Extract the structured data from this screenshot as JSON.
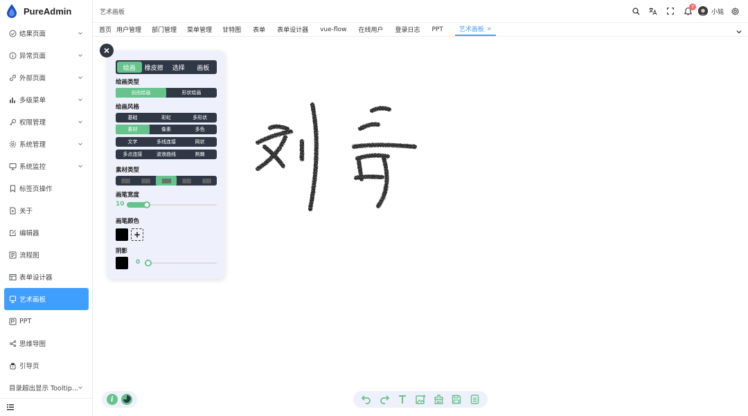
{
  "app": {
    "name": "PureAdmin"
  },
  "sidebar": {
    "items": [
      {
        "label": "结果页面",
        "icon": "check-circle-icon",
        "expandable": true
      },
      {
        "label": "异常页面",
        "icon": "info-circle-icon",
        "expandable": true
      },
      {
        "label": "外部页面",
        "icon": "link-icon",
        "expandable": true
      },
      {
        "label": "多级菜单",
        "icon": "bar-chart-icon",
        "expandable": true
      },
      {
        "label": "权限管理",
        "icon": "key-icon",
        "expandable": true
      },
      {
        "label": "系统管理",
        "icon": "gear-icon",
        "expandable": true
      },
      {
        "label": "系统监控",
        "icon": "monitor-icon",
        "expandable": true
      },
      {
        "label": "标签页操作",
        "icon": "bookmark-icon",
        "expandable": false
      },
      {
        "label": "关于",
        "icon": "document-icon",
        "expandable": false
      },
      {
        "label": "编辑器",
        "icon": "edit-icon",
        "expandable": false
      },
      {
        "label": "流程图",
        "icon": "flowchart-icon",
        "expandable": false
      },
      {
        "label": "表单设计器",
        "icon": "form-icon",
        "expandable": false
      },
      {
        "label": "艺术画板",
        "icon": "drawing-board-icon",
        "expandable": false,
        "active": true
      },
      {
        "label": "PPT",
        "icon": "ppt-icon",
        "expandable": false
      },
      {
        "label": "思维导图",
        "icon": "mindmap-icon",
        "expandable": false
      },
      {
        "label": "引导页",
        "icon": "guide-icon",
        "expandable": false
      },
      {
        "label": "目录超出显示 Tooltip...",
        "icon": "",
        "expandable": true
      }
    ]
  },
  "header": {
    "breadcrumb": "艺术画板",
    "notification_count": "7",
    "username": "小铭"
  },
  "tabs": [
    {
      "label": "首页"
    },
    {
      "label": "用户管理"
    },
    {
      "label": "部门管理"
    },
    {
      "label": "菜单管理"
    },
    {
      "label": "甘特图"
    },
    {
      "label": "表单"
    },
    {
      "label": "表单设计器"
    },
    {
      "label": "vue-flow"
    },
    {
      "label": "在线用户"
    },
    {
      "label": "登录日志"
    },
    {
      "label": "PPT"
    },
    {
      "label": "艺术画板",
      "active": true
    }
  ],
  "panel": {
    "modes": [
      "绘画",
      "橡皮擦",
      "选择",
      "画板"
    ],
    "active_mode": "绘画",
    "draw_type_title": "绘画类型",
    "draw_types": [
      "自由绘画",
      "形状绘画"
    ],
    "style_title": "绘画风格",
    "style_rows": [
      [
        "基础",
        "彩虹",
        "多形状"
      ],
      [
        "素材",
        "像素",
        "多色"
      ],
      [
        "文字",
        "多线连接",
        "网状"
      ],
      [
        "多点连接",
        "波浪曲线",
        "荆棘"
      ]
    ],
    "active_style": "素材",
    "material_title": "素材类型",
    "material_active_index": 2,
    "width_title": "画笔宽度",
    "width_value": "10",
    "color_title": "画笔颜色",
    "brush_color": "#000000",
    "shadow_title": "阴影",
    "shadow_color": "#000000",
    "shadow_value": "0"
  },
  "canvas": {
    "strokes_color": "#3a3a3a"
  },
  "colors": {
    "accent": "#409eff",
    "panel_green": "#66c38c",
    "panel_dark": "#303846"
  }
}
